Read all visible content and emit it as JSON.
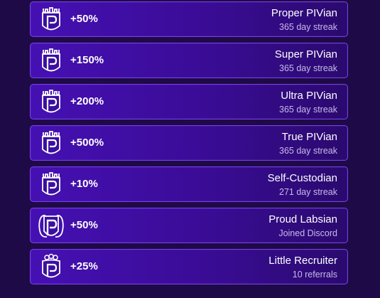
{
  "achievements": [
    {
      "bonus": "+50%",
      "title": "Proper PIVian",
      "subtitle": "365 day streak",
      "icon": "castle-pi-shield-icon"
    },
    {
      "bonus": "+150%",
      "title": "Super PIVian",
      "subtitle": "365 day streak",
      "icon": "castle-pi-shield-icon"
    },
    {
      "bonus": "+200%",
      "title": "Ultra PIVian",
      "subtitle": "365 day streak",
      "icon": "castle-pi-shield-icon"
    },
    {
      "bonus": "+500%",
      "title": "True PIVian",
      "subtitle": "365 day streak",
      "icon": "castle-pi-shield-icon"
    },
    {
      "bonus": "+10%",
      "title": "Self-Custodian",
      "subtitle": "271 day streak",
      "icon": "castle-pi-shield-icon"
    },
    {
      "bonus": "+50%",
      "title": "Proud Labsian",
      "subtitle": "Joined Discord",
      "icon": "discord-pi-shield-icon"
    },
    {
      "bonus": "+25%",
      "title": "Little Recruiter",
      "subtitle": "10 referrals",
      "icon": "recruiter-pi-shield-icon"
    }
  ],
  "colors": {
    "background": "#1e0a47",
    "card": "#4510b3",
    "card_border": "#7a3ee6",
    "text": "#ffffff",
    "subtext": "#c7b8ea"
  }
}
